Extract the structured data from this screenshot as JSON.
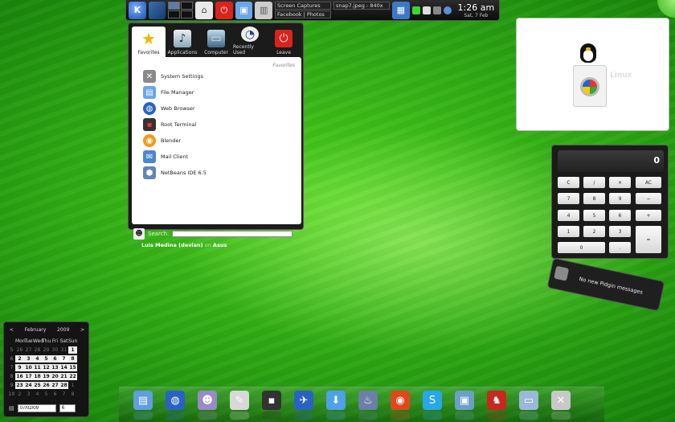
{
  "panel": {
    "tasks": [
      "Screen Captures",
      "snap7.jpeg - 840x",
      "Facebook | Photos"
    ],
    "clock_time": "1:26 am",
    "clock_date": "Sat, 7 Feb"
  },
  "kickoff": {
    "tabs": [
      {
        "label": "Favorites"
      },
      {
        "label": "Applications"
      },
      {
        "label": "Computer"
      },
      {
        "label": "Recently Used"
      },
      {
        "label": "Leave"
      }
    ],
    "section_header": "Favorites",
    "items": [
      {
        "label": "System Settings"
      },
      {
        "label": "File Manager"
      },
      {
        "label": "Web Browser"
      },
      {
        "label": "Root Terminal"
      },
      {
        "label": "Blender"
      },
      {
        "label": "Mail Client"
      },
      {
        "label": "NetBeans IDE 6.5"
      }
    ],
    "search_label": "Search:",
    "search_value": "",
    "user_name": "Luis Medina (devian)",
    "user_on": "on",
    "user_host": "Asus"
  },
  "frame": {
    "caption": "Linux"
  },
  "calculator": {
    "display": "0",
    "keys": [
      "C",
      "/",
      "×",
      "AC",
      "7",
      "8",
      "9",
      "−",
      "4",
      "5",
      "6",
      "+",
      "1",
      "2",
      "3",
      "=",
      "0",
      "."
    ]
  },
  "pidgin": {
    "message": "No new Pidgin messages"
  },
  "calendar": {
    "prev": "<",
    "month": "February",
    "year": "2009",
    "next": ">",
    "weekdays": [
      "Mon",
      "Tue",
      "Wed",
      "Thu",
      "Fri",
      "Sat",
      "Sun"
    ],
    "weeks": [
      {
        "wk": "5",
        "days": [
          "26",
          "27",
          "28",
          "29",
          "30",
          "31",
          "1"
        ]
      },
      {
        "wk": "6",
        "days": [
          "2",
          "3",
          "4",
          "5",
          "6",
          "7",
          "8"
        ]
      },
      {
        "wk": "7",
        "days": [
          "9",
          "10",
          "11",
          "12",
          "13",
          "14",
          "15"
        ]
      },
      {
        "wk": "8",
        "days": [
          "16",
          "17",
          "18",
          "19",
          "20",
          "21",
          "22"
        ]
      },
      {
        "wk": "9",
        "days": [
          "23",
          "24",
          "25",
          "26",
          "27",
          "28",
          "1"
        ]
      },
      {
        "wk": "10",
        "days": [
          "2",
          "3",
          "4",
          "5",
          "6",
          "7",
          "8"
        ]
      }
    ],
    "date_value": "07/02/09",
    "week_value": "6"
  },
  "dock": {
    "icons": [
      "file-manager-icon",
      "web-browser-icon",
      "pidgin-icon",
      "screenshot-icon",
      "terminal-icon",
      "thunderbird-icon",
      "download-icon",
      "netbeans-icon",
      "blender-icon",
      "skype-icon",
      "image-viewer-icon",
      "parrot-icon",
      "computer-icon",
      "system-settings-icon"
    ]
  }
}
